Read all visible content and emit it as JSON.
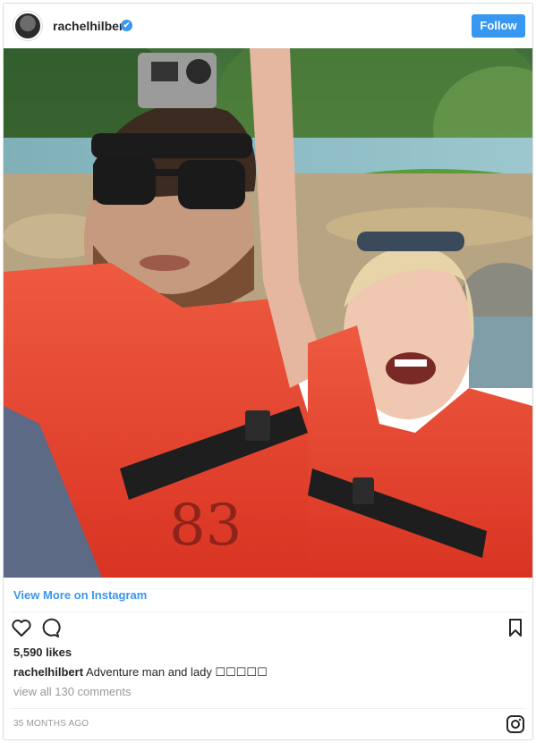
{
  "post": {
    "username": "rachelhilbert",
    "verified_glyph": "✔",
    "follow_label": "Follow",
    "view_more_label": "View More on Instagram",
    "likes": "5,590 likes",
    "caption_user": "rachelhilbert",
    "caption_text": "Adventure man and lady ☐☐☐☐☐",
    "comments_link": "view all 130 comments",
    "timestamp": "35 MONTHS AGO",
    "photo_text": "83"
  },
  "icons": {
    "like": "heart-icon",
    "comment": "comment-icon",
    "save": "bookmark-icon",
    "brand": "instagram-icon",
    "verified": "verified-badge-icon"
  },
  "colors": {
    "accent": "#3897f0",
    "text": "#262626",
    "muted": "#999999",
    "border": "#dbdbdb",
    "vest": "#e8412f"
  }
}
